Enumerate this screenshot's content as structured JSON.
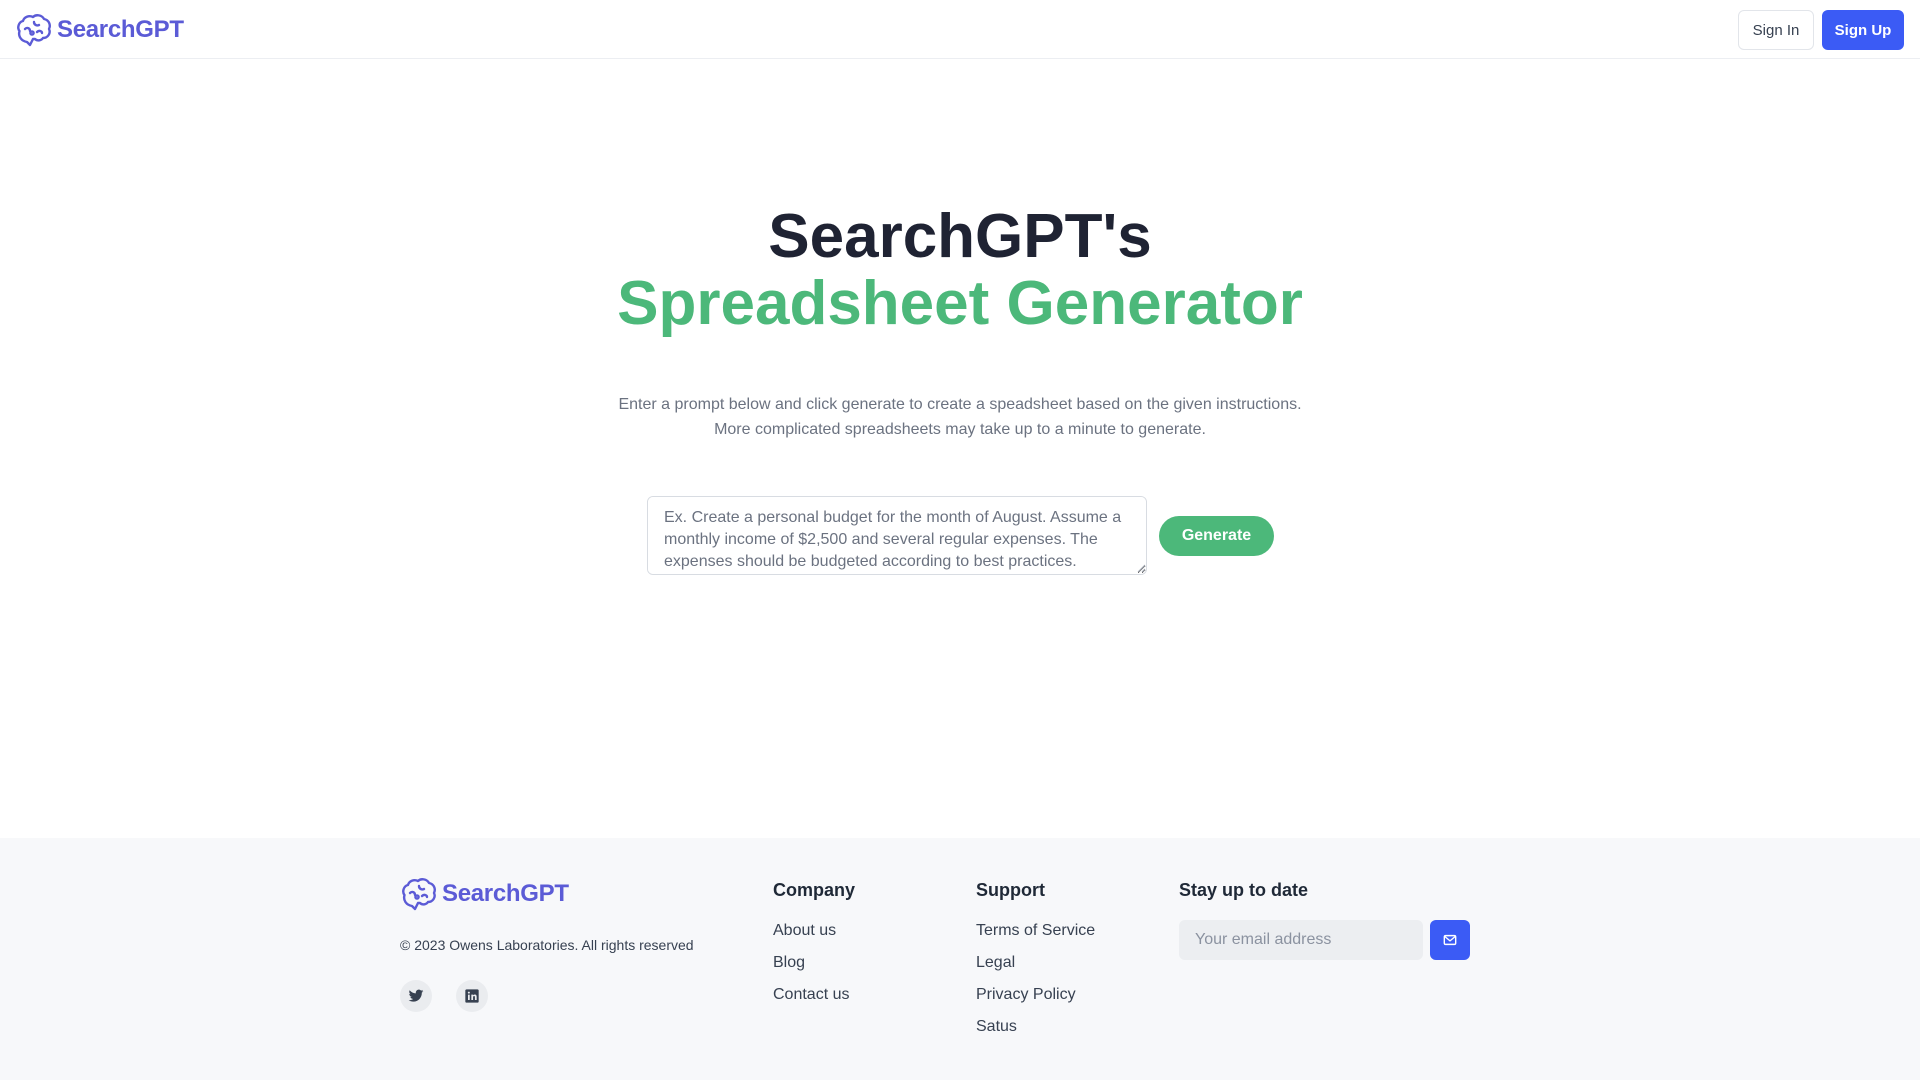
{
  "header": {
    "brand": "SearchGPT",
    "logo_icon": "brain-icon",
    "sign_in_label": "Sign In",
    "sign_up_label": "Sign Up"
  },
  "hero": {
    "title_line1": "SearchGPT's",
    "title_line2": "Spreadsheet Generator",
    "description": "Enter a prompt below and click generate to create a speadsheet based on the given instructions. More complicated spreadsheets may take up to a minute to generate.",
    "prompt_placeholder": "Ex. Create a personal budget for the month of August. Assume a monthly income of $2,500 and several regular expenses. The expenses should be budgeted according to best practices.",
    "generate_label": "Generate"
  },
  "footer": {
    "brand": "SearchGPT",
    "copyright": "© 2023 Owens Laboratories. All rights reserved",
    "social": [
      {
        "icon": "twitter-icon"
      },
      {
        "icon": "linkedin-icon"
      }
    ],
    "company": {
      "heading": "Company",
      "links": [
        "About us",
        "Blog",
        "Contact us"
      ]
    },
    "support": {
      "heading": "Support",
      "links": [
        "Terms of Service",
        "Legal",
        "Privacy Policy",
        "Satus"
      ]
    },
    "newsletter": {
      "heading": "Stay up to date",
      "email_placeholder": "Your email address",
      "submit_icon": "mail-icon"
    }
  },
  "colors": {
    "brand": "#5b5bd6",
    "primary_button": "#3b5bf5",
    "accent_green": "#4cb87a",
    "title_dark": "#1f2333",
    "footer_bg": "#f7f8fa"
  }
}
